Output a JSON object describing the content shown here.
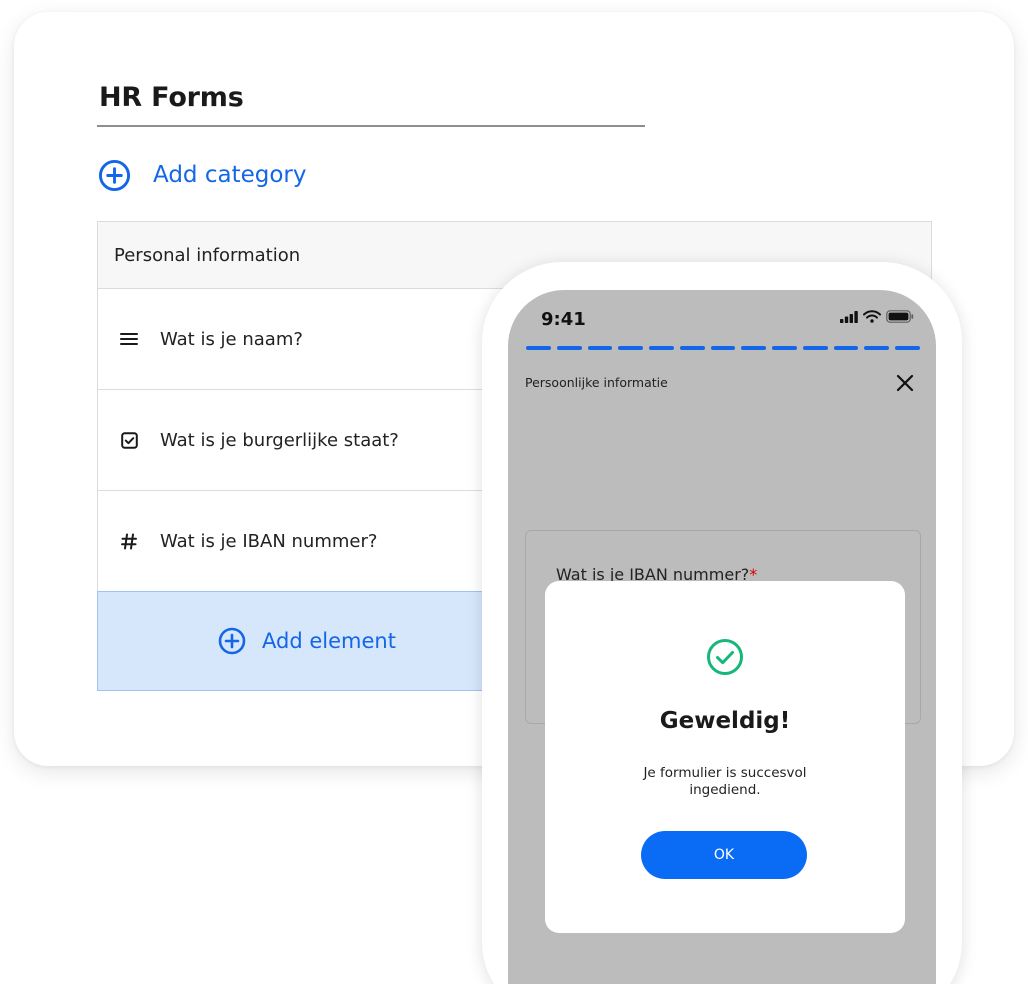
{
  "card": {
    "title": "HR Forms",
    "add_category_label": "Add category",
    "table": {
      "header": "Personal information",
      "rows": [
        {
          "icon": "menu-lines-icon",
          "label": "Wat is je naam?"
        },
        {
          "icon": "checkbox-icon",
          "label": "Wat is je burgerlijke staat?"
        },
        {
          "icon": "hash-icon",
          "label": "Wat is je IBAN nummer?"
        }
      ],
      "add_element_label": "Add element"
    }
  },
  "phone": {
    "status_bar": {
      "time": "9:41",
      "icons": [
        "signal-icon",
        "wifi-icon",
        "battery-icon"
      ]
    },
    "progress_segments": 13,
    "section_title": "Persoonlijke informatie",
    "close_icon": "close-icon",
    "field": {
      "label": "Wat is je IBAN nummer?",
      "required_marker": "*"
    },
    "modal": {
      "icon": "success-check-icon",
      "title": "Geweldig!",
      "message": "Je formulier is succesvol ingediend.",
      "ok_label": "OK"
    }
  },
  "colors": {
    "accent": "#1466e8",
    "button": "#0a6cf5",
    "success": "#15b87a",
    "add_element_bg": "#d6e6fb",
    "overlay": "#bcbcbc",
    "required": "#d90000"
  }
}
